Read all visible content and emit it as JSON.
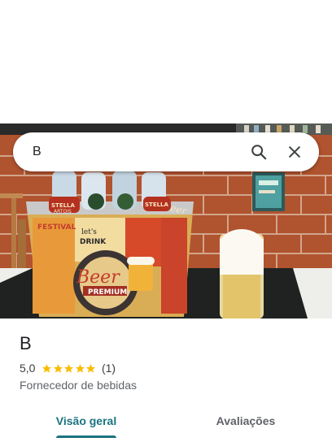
{
  "search": {
    "query": "B",
    "search_icon": "search-icon",
    "close_icon": "close-icon"
  },
  "photo": {
    "bucket_texts": [
      "FESTIVAL",
      "let's DRINK",
      "Beer",
      "PREMIUM",
      "Beer"
    ],
    "bottle_labels": [
      "STELLA ARTOIS",
      "STELLA"
    ]
  },
  "place": {
    "name": "B",
    "rating": "5,0",
    "stars": 5,
    "review_count": "(1)",
    "category": "Fornecedor de bebidas"
  },
  "tabs": [
    {
      "label": "Visão geral",
      "active": true
    },
    {
      "label": "Avaliações",
      "active": false
    }
  ],
  "colors": {
    "accent": "#1a7380",
    "star": "#fbbc04",
    "text_primary": "#202124",
    "text_secondary": "#5f6368"
  }
}
